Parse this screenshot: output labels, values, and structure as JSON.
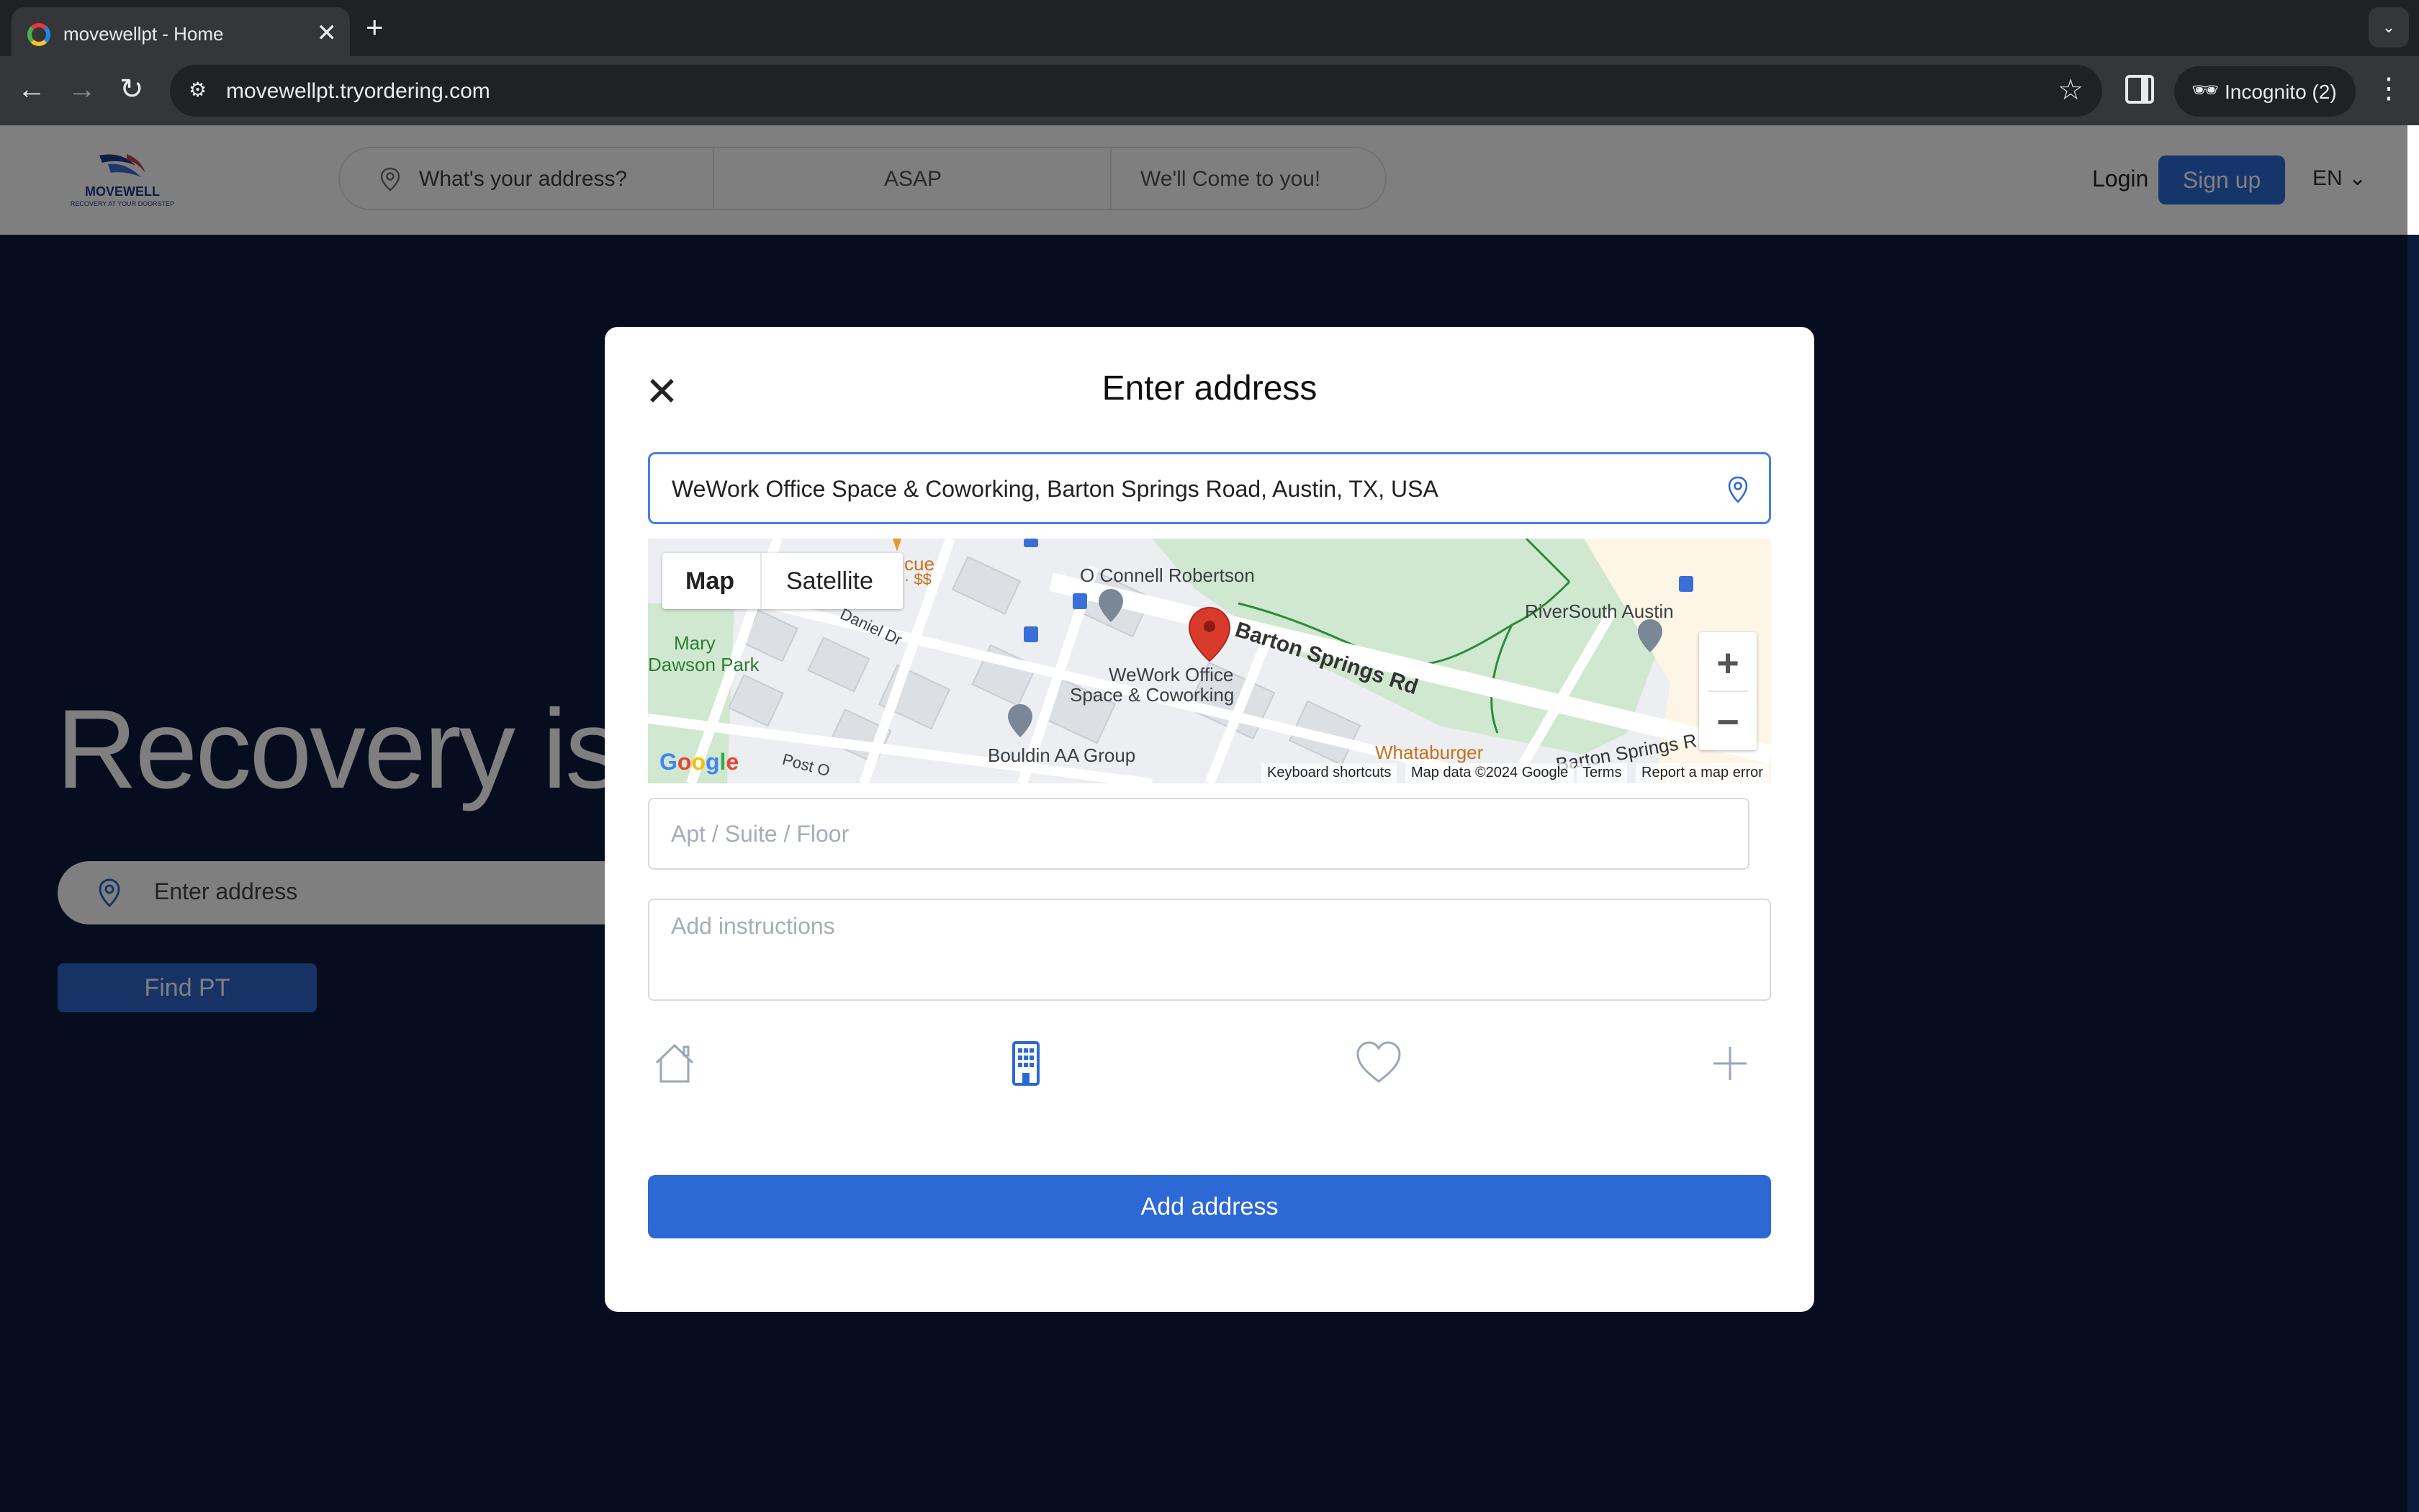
{
  "browser": {
    "tab_title": "movewellpt - Home",
    "url": "movewellpt.tryordering.com",
    "incognito_label": "Incognito (2)",
    "icons": [
      "back-icon",
      "forward-icon",
      "reload-icon",
      "site-info-icon",
      "star-icon",
      "side-panel-icon",
      "incognito-icon",
      "menu-icon"
    ]
  },
  "header": {
    "logo_name": "MOVEWELL",
    "logo_tagline": "RECOVERY AT YOUR DOORSTEP",
    "address_placeholder": "What's your address?",
    "time_label": "ASAP",
    "service_label": "We'll Come to you!",
    "login_label": "Login",
    "signup_label": "Sign up",
    "language": "EN"
  },
  "hero": {
    "title": "Recovery is",
    "address_placeholder": "Enter address",
    "button_label": "Find PT"
  },
  "modal": {
    "title": "Enter address",
    "address_value": "WeWork Office Space & Coworking, Barton Springs Road, Austin, TX, USA",
    "apt_placeholder": "Apt / Suite / Floor",
    "instructions_placeholder": "Add instructions",
    "add_button_label": "Add address",
    "address_types": [
      "home-icon",
      "building-icon",
      "heart-icon",
      "plus-icon"
    ],
    "selected_type": "building-icon",
    "map": {
      "type_map": "Map",
      "type_satellite": "Satellite",
      "labels": {
        "oconnell": "O Connell Robertson",
        "riversouth": "RiverSouth Austin",
        "mary": "Mary",
        "dawson": "Dawson Park",
        "daniel": "Daniel Dr",
        "barton": "Barton Springs Rd",
        "barton2": "Barton Springs R",
        "wework1": "WeWork Office",
        "wework2": "Space & Coworking",
        "bouldin": "Bouldin AA Group",
        "whataburger": "Whataburger",
        "post": "Post O",
        "cue": "cue",
        "price": "· $$"
      },
      "footer": {
        "shortcuts": "Keyboard shortcuts",
        "mapdata": "Map data ©2024 Google",
        "terms": "Terms",
        "report": "Report a map error"
      },
      "google": "Google",
      "zoom_in": "+",
      "zoom_out": "−"
    }
  },
  "colors": {
    "primary": "#2d69d4",
    "hero_bg": "#0c1a3c",
    "pin_red": "#d93a2b",
    "park_green": "#cfe8cf"
  }
}
